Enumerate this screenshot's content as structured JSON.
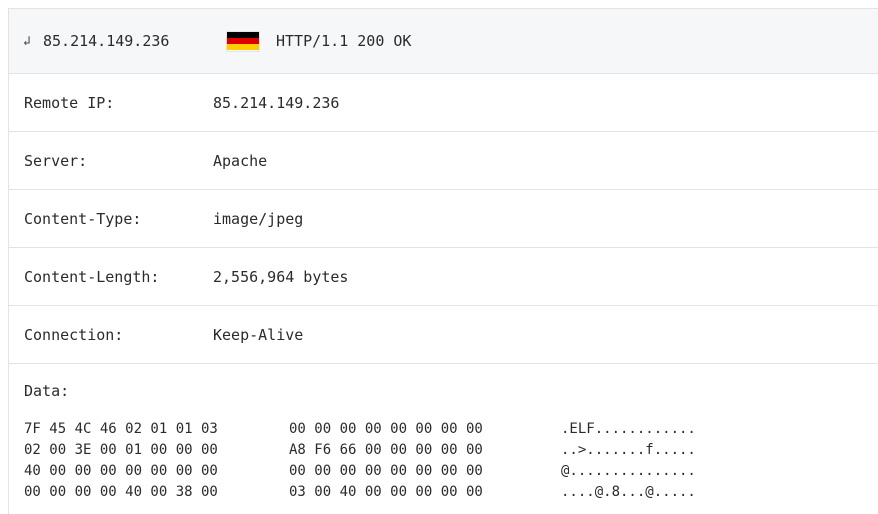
{
  "header": {
    "return_glyph": "↲",
    "ip": "85.214.149.236",
    "flag_icon": "germany-flag-icon",
    "flag_colors": [
      "#000000",
      "#dd0000",
      "#ffce00"
    ],
    "status": "HTTP/1.1 200 OK"
  },
  "rows": [
    {
      "key": "Remote IP:",
      "value": "85.214.149.236"
    },
    {
      "key": "Server:",
      "value": "Apache"
    },
    {
      "key": "Content-Type:",
      "value": "image/jpeg"
    },
    {
      "key": "Content-Length:",
      "value": "2,556,964 bytes"
    },
    {
      "key": "Connection:",
      "value": "Keep-Alive"
    }
  ],
  "data": {
    "label": "Data:",
    "lines": [
      {
        "hex_a": "7F 45 4C 46 02 01 01 03",
        "hex_b": "00 00 00 00 00 00 00 00",
        "ascii": ".ELF............"
      },
      {
        "hex_a": "02 00 3E 00 01 00 00 00",
        "hex_b": "A8 F6 66 00 00 00 00 00",
        "ascii": "..>.......f....."
      },
      {
        "hex_a": "40 00 00 00 00 00 00 00",
        "hex_b": "00 00 00 00 00 00 00 00",
        "ascii": "@..............."
      },
      {
        "hex_a": "00 00 00 00 40 00 38 00",
        "hex_b": "03 00 40 00 00 00 00 00",
        "ascii": "....@.8...@....."
      }
    ]
  }
}
